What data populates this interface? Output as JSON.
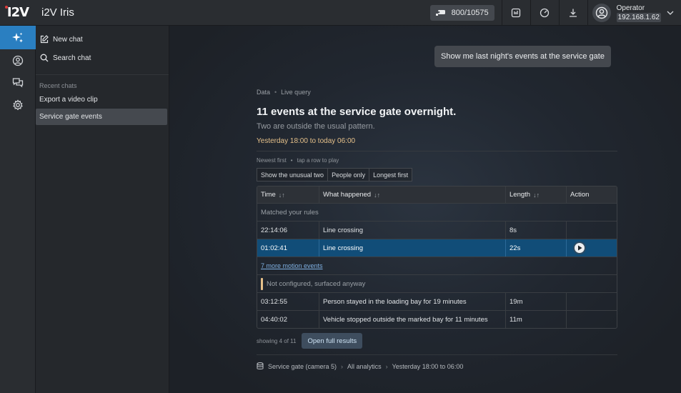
{
  "app": {
    "logo": "I2V",
    "title": "i2V Iris"
  },
  "topbar": {
    "camera_count": "800/10575",
    "user_role": "Operator",
    "user_ip": "192.168.1.62",
    "icons": [
      "camera-icon",
      "export-report-icon",
      "speedometer-icon",
      "download-icon",
      "user-avatar-icon",
      "chevron-down-icon"
    ]
  },
  "rail": {
    "items": [
      {
        "icon": "sparkle-icon",
        "active": true
      },
      {
        "icon": "user-circle-icon",
        "active": false
      },
      {
        "icon": "chat-bubbles-icon",
        "active": false
      },
      {
        "icon": "gear-icon",
        "active": false
      }
    ]
  },
  "sidebar": {
    "new_chat": "New chat",
    "search_chat": "Search chat",
    "section_label": "Recent chats",
    "chats": [
      {
        "label": "Export a video clip",
        "selected": false
      },
      {
        "label": "Service gate events",
        "selected": true
      }
    ]
  },
  "chat": {
    "user_message": "Show me last night's events at the service gate",
    "crumb_1": "Data",
    "crumb_2": "Live query",
    "headline": "11 events at the service gate overnight.",
    "subline": "Two are outside the usual pattern.",
    "range": "Yesterday 18:00 to today 06:00",
    "sort_note": "Newest first",
    "sort_hint": "tap a row to play",
    "chips": [
      "Show the unusual two",
      "People only",
      "Longest first"
    ],
    "columns": {
      "time": "Time",
      "what": "What happened",
      "length": "Length",
      "action": "Action"
    },
    "group_1": "Matched your rules",
    "rows_1": [
      {
        "time": "22:14:06",
        "what": "Line crossing",
        "length": "8s",
        "selected": false
      },
      {
        "time": "01:02:41",
        "what": "Line crossing",
        "length": "22s",
        "selected": true
      }
    ],
    "more_link": "7 more motion events",
    "group_2": "Not configured, surfaced anyway",
    "rows_2": [
      {
        "time": "03:12:55",
        "what": "Person stayed in the loading bay for 19 minutes",
        "length": "19m"
      },
      {
        "time": "04:40:02",
        "what": "Vehicle stopped outside the marked bay for 11 minutes",
        "length": "11m"
      }
    ],
    "showing": "showing 4 of 11",
    "open_button": "Open full results",
    "source": {
      "camera": "Service gate (camera 5)",
      "scope": "All analytics",
      "range": "Yesterday 18:00 to 06:00"
    },
    "accent_color": "#114d78",
    "warn_color": "#e5c08a"
  }
}
